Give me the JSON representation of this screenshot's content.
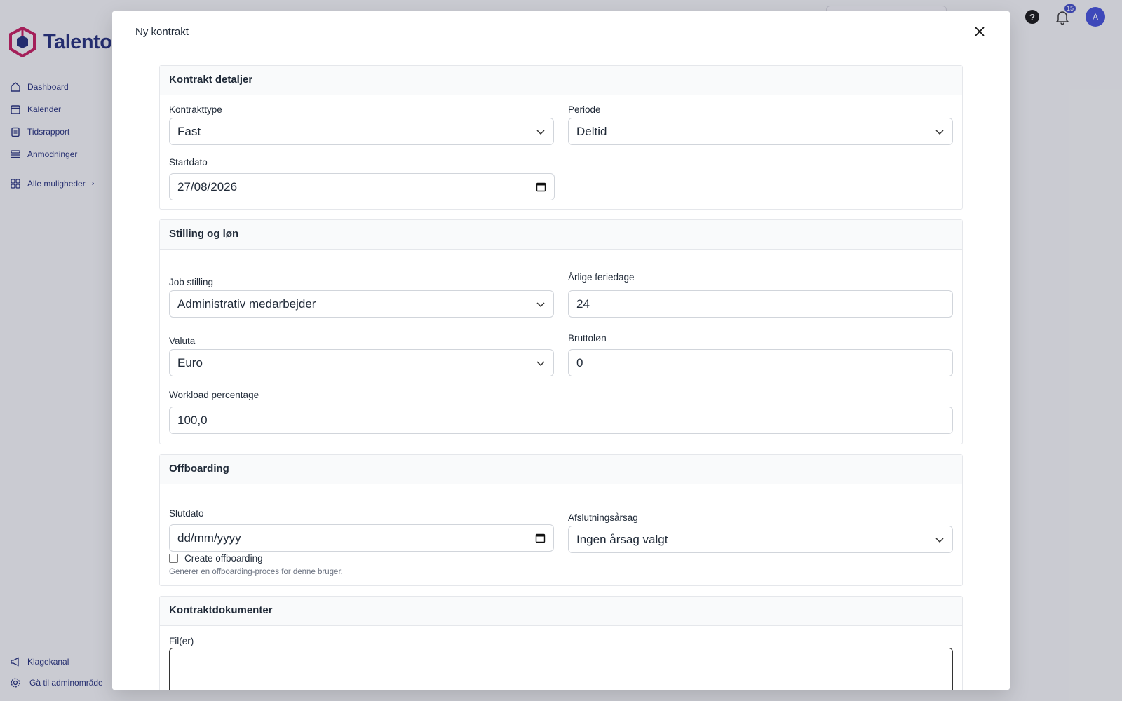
{
  "app": {
    "brand": "Talento",
    "nav": [
      {
        "label": "Dashboard",
        "icon": "home-icon"
      },
      {
        "label": "Kalender",
        "icon": "calendar-icon"
      },
      {
        "label": "Tidsrapport",
        "icon": "clipboard-icon"
      },
      {
        "label": "Anmodninger",
        "icon": "list-icon"
      }
    ],
    "more_label": "Alle muligheder",
    "bottom_nav": [
      {
        "label": "Klagekanal",
        "icon": "megaphone-icon"
      },
      {
        "label": "Gå til adminområde",
        "icon": "gear-icon"
      }
    ],
    "notifications_count": "15",
    "avatar_initial": "A",
    "accent_color": "#1e2a78",
    "logo_color": "#c2185b"
  },
  "modal": {
    "title": "Ny kontrakt",
    "sections": {
      "details": {
        "heading": "Kontrakt detaljer",
        "contract_type": {
          "label": "Kontrakttype",
          "value": "Fast"
        },
        "period": {
          "label": "Periode",
          "value": "Deltid"
        },
        "start_date": {
          "label": "Startdato",
          "value": "27/08/2026"
        }
      },
      "position": {
        "heading": "Stilling og løn",
        "job": {
          "label": "Job stilling",
          "value": "Administrativ medarbejder"
        },
        "vacation": {
          "label": "Årlige feriedage",
          "value": "24"
        },
        "currency": {
          "label": "Valuta",
          "value": "Euro"
        },
        "gross": {
          "label": "Bruttoløn",
          "value": "0"
        },
        "workload": {
          "label": "Workload percentage",
          "value": "100,0"
        }
      },
      "offboarding": {
        "heading": "Offboarding",
        "end_date": {
          "label": "Slutdato",
          "placeholder": "dd/mm/yyyy"
        },
        "reason": {
          "label": "Afslutningsårsag",
          "value": "Ingen årsag valgt"
        },
        "checkbox_label": "Create offboarding",
        "hint": "Generer en offboarding-proces for denne bruger."
      },
      "documents": {
        "heading": "Kontraktdokumenter",
        "files_label": "Fil(er)"
      }
    }
  }
}
